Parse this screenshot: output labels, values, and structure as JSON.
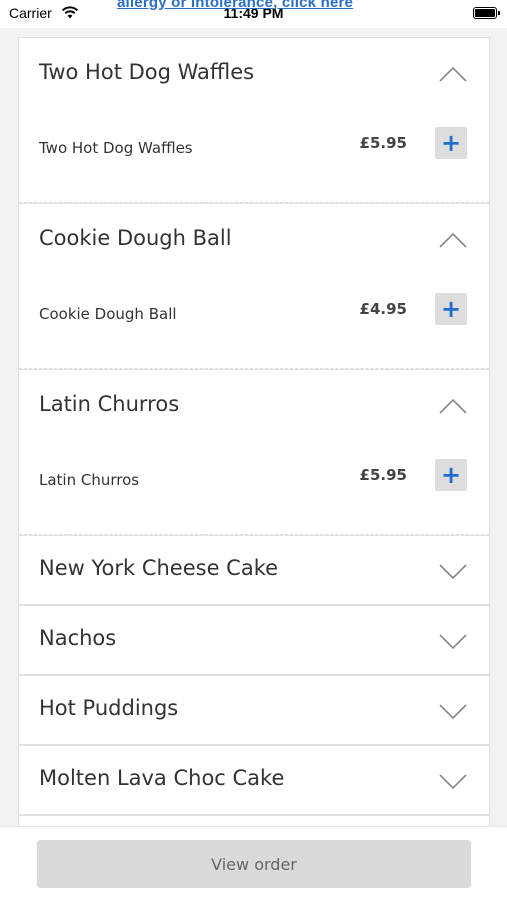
{
  "status_bar": {
    "carrier": "Carrier",
    "time": "11:49 PM"
  },
  "allergy_link": "allergy or intolerance, click here",
  "categories": [
    {
      "title": "Two Hot Dog Waffles",
      "state": "expanded",
      "items": [
        {
          "name": "Two Hot Dog Waffles",
          "price": "£5.95",
          "add": "+"
        }
      ]
    },
    {
      "title": "Cookie Dough Ball",
      "state": "expanded",
      "items": [
        {
          "name": "Cookie Dough Ball",
          "price": "£4.95",
          "add": "+"
        }
      ]
    },
    {
      "title": "Latin Churros",
      "state": "expanded",
      "items": [
        {
          "name": "Latin Churros",
          "price": "£5.95",
          "add": "+"
        }
      ]
    },
    {
      "title": "New York Cheese Cake",
      "state": "collapsed"
    },
    {
      "title": "Nachos",
      "state": "collapsed"
    },
    {
      "title": "Hot Puddings",
      "state": "collapsed"
    },
    {
      "title": "Molten Lava Choc Cake",
      "state": "collapsed"
    }
  ],
  "footer": {
    "view_order_label": "View order"
  },
  "colors": {
    "accent": "#1f6fd1",
    "link": "#2a6fc9",
    "button_bg": "#dadada"
  }
}
